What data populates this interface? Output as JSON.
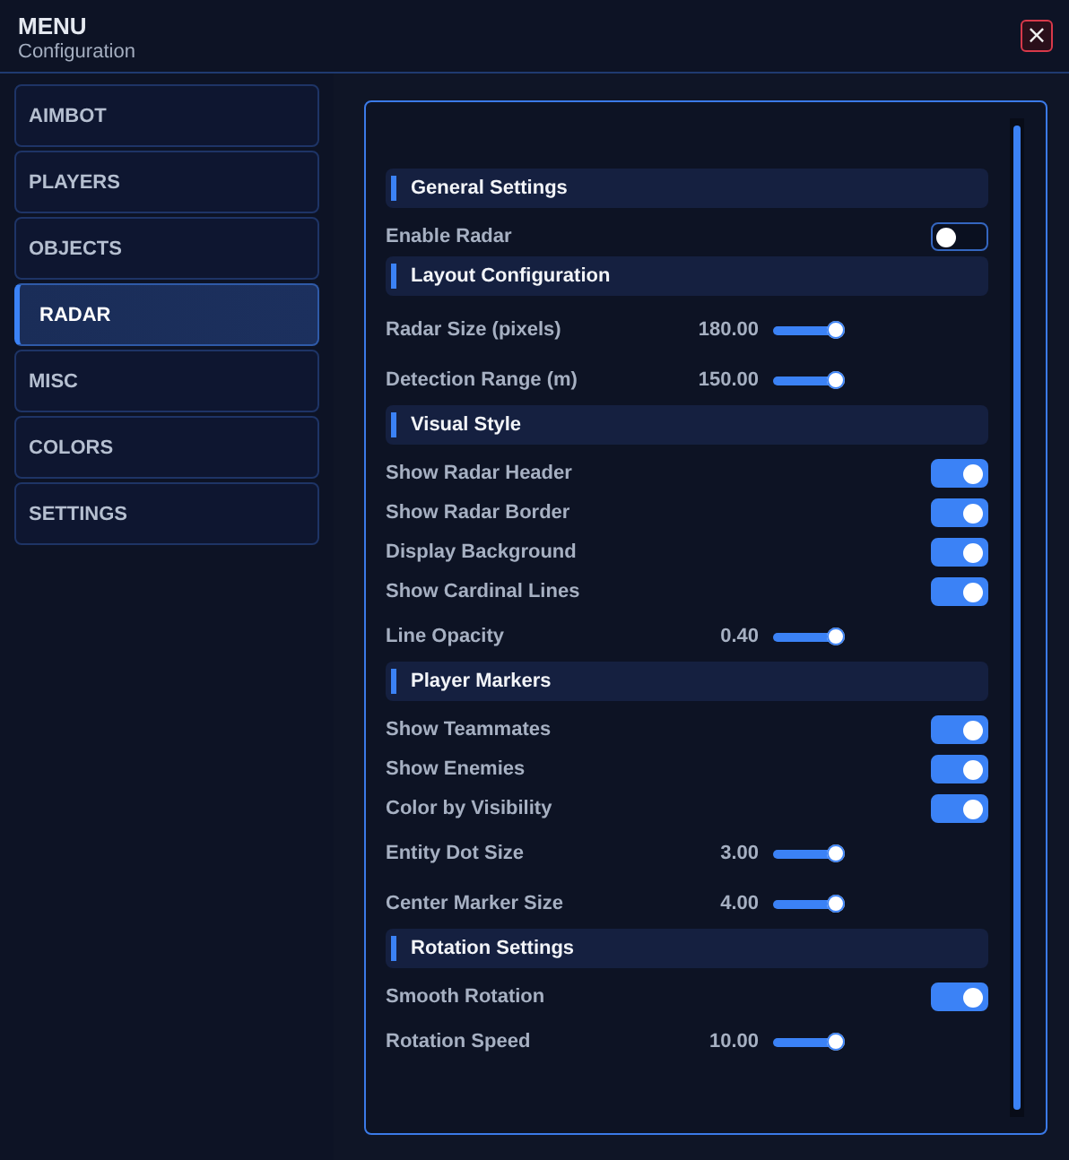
{
  "header": {
    "title": "MENU",
    "subtitle": "Configuration",
    "close": "×"
  },
  "sidebar": {
    "items": [
      {
        "label": "AIMBOT",
        "selected": false
      },
      {
        "label": "PLAYERS",
        "selected": false
      },
      {
        "label": "OBJECTS",
        "selected": false
      },
      {
        "label": "RADAR",
        "selected": true
      },
      {
        "label": "MISC",
        "selected": false
      },
      {
        "label": "COLORS",
        "selected": false
      },
      {
        "label": "SETTINGS",
        "selected": false
      }
    ]
  },
  "panel": {
    "items": [
      {
        "kind": "section",
        "label": "General Settings"
      },
      {
        "kind": "toggle",
        "label": "Enable Radar",
        "on": false
      },
      {
        "kind": "section",
        "label": "Layout Configuration"
      },
      {
        "kind": "slider",
        "label": "Radar Size (pixels)",
        "value": "180.00"
      },
      {
        "kind": "slider",
        "label": "Detection Range (m)",
        "value": "150.00"
      },
      {
        "kind": "section",
        "label": "Visual Style"
      },
      {
        "kind": "toggle",
        "label": "Show Radar Header",
        "on": true
      },
      {
        "kind": "toggle",
        "label": "Show Radar Border",
        "on": true
      },
      {
        "kind": "toggle",
        "label": "Display Background",
        "on": true
      },
      {
        "kind": "toggle",
        "label": "Show Cardinal Lines",
        "on": true
      },
      {
        "kind": "slider",
        "label": "Line Opacity",
        "value": "0.40"
      },
      {
        "kind": "section",
        "label": "Player Markers"
      },
      {
        "kind": "toggle",
        "label": "Show Teammates",
        "on": true
      },
      {
        "kind": "toggle",
        "label": "Show Enemies",
        "on": true
      },
      {
        "kind": "toggle",
        "label": "Color by Visibility",
        "on": true
      },
      {
        "kind": "slider",
        "label": "Entity Dot Size",
        "value": "3.00"
      },
      {
        "kind": "slider",
        "label": "Center Marker Size",
        "value": "4.00"
      },
      {
        "kind": "section",
        "label": "Rotation Settings"
      },
      {
        "kind": "toggle",
        "label": "Smooth Rotation",
        "on": true
      },
      {
        "kind": "slider",
        "label": "Rotation Speed",
        "value": "10.00"
      }
    ]
  }
}
